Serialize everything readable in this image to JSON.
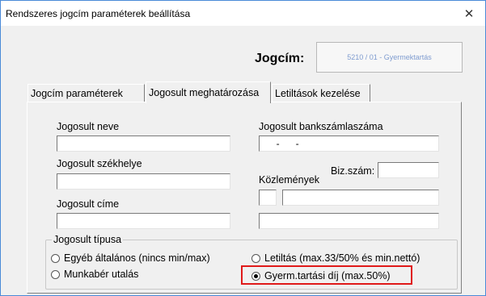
{
  "window": {
    "title": "Rendszeres jogcím paraméterek beállítása",
    "close_glyph": "✕"
  },
  "header": {
    "jogcim_label": "Jogcím:",
    "jogcim_value": "5210 / 01 - Gyermektartás"
  },
  "tabs": [
    {
      "label": "Jogcím paraméterek",
      "active": false
    },
    {
      "label": "Jogosult meghatározása",
      "active": true
    },
    {
      "label": "Letiltások kezelése",
      "active": false
    }
  ],
  "form": {
    "name_label": "Jogosult neve",
    "name_value": "",
    "seat_label": "Jogosult székhelye",
    "seat_value": "",
    "address_label": "Jogosult címe",
    "address_value": "",
    "bank_label": "Jogosult bankszámlaszáma",
    "bank_value": "     -      -",
    "biz_label": "Biz.szám:",
    "biz_value": "",
    "comments_label": "Közlemények",
    "comment_small_value": "",
    "comment_line1_value": "",
    "comment_line2_value": ""
  },
  "type_group": {
    "title": "Jogosult típusa",
    "options": [
      {
        "label": "Egyéb általános (nincs min/max)",
        "checked": false
      },
      {
        "label": "Munkabér utalás",
        "checked": false
      },
      {
        "label": "Letiltás (max.33/50% és min.nettó)",
        "checked": false
      },
      {
        "label": "Gyerm.tartási díj (max.50%)",
        "checked": true
      }
    ]
  },
  "colors": {
    "highlight": "#e01919",
    "jogcim_value_text": "#7f9cd0",
    "window_border": "#4a8ad8"
  }
}
